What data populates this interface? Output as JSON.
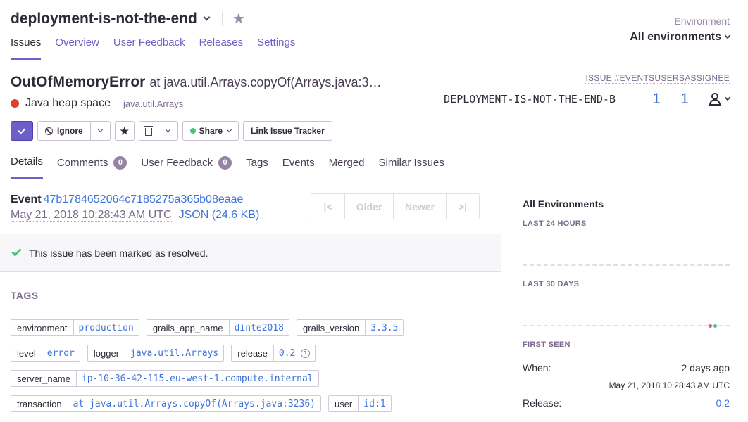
{
  "header": {
    "project_name": "deployment-is-not-the-end",
    "nav": [
      "Issues",
      "Overview",
      "User Feedback",
      "Releases",
      "Settings"
    ],
    "environment_label": "Environment",
    "environment_value": "All environments"
  },
  "issue": {
    "title": "OutOfMemoryError",
    "culprit": "at java.util.Arrays.copyOf(Arrays.java:3…",
    "message": "Java heap space",
    "location": "java.util.Arrays",
    "stats_header": "ISSUE #EVENTSUSERSASSIGNEE",
    "short_id": "DEPLOYMENT-IS-NOT-THE-END-B",
    "events": "1",
    "users": "1"
  },
  "actions": {
    "ignore": "Ignore",
    "share": "Share",
    "link_tracker": "Link Issue Tracker"
  },
  "tabs": [
    {
      "label": "Details"
    },
    {
      "label": "Comments",
      "badge": "0"
    },
    {
      "label": "User Feedback",
      "badge": "0"
    },
    {
      "label": "Tags"
    },
    {
      "label": "Events"
    },
    {
      "label": "Merged"
    },
    {
      "label": "Similar Issues"
    }
  ],
  "event": {
    "label": "Event",
    "id": "47b1784652064c7185275a365b08eaae",
    "date": "May 21, 2018 10:28:43 AM UTC",
    "json": "JSON (24.6 KB)",
    "pager": {
      "first": "|<",
      "older": "Older",
      "newer": "Newer",
      "last": ">|"
    }
  },
  "resolved_message": "This issue has been marked as resolved.",
  "tags_title": "TAGS",
  "tags": [
    {
      "key": "environment",
      "value": "production"
    },
    {
      "key": "grails_app_name",
      "value": "dinte2018"
    },
    {
      "key": "grails_version",
      "value": "3.3.5"
    },
    {
      "key": "level",
      "value": "error"
    },
    {
      "key": "logger",
      "value": "java.util.Arrays"
    },
    {
      "key": "release",
      "value": "0.2"
    },
    {
      "key": "server_name",
      "value": "ip-10-36-42-115.eu-west-1.compute.internal"
    },
    {
      "key": "transaction",
      "value": "at java.util.Arrays.copyOf(Arrays.java:3236)"
    },
    {
      "key": "user",
      "value": "id:1"
    }
  ],
  "sidebar": {
    "title": "All Environments",
    "last_24_hours": "LAST 24 HOURS",
    "last_30_days": "LAST 30 DAYS",
    "first_seen": "FIRST SEEN",
    "when_label": "When:",
    "when_value": "2 days ago",
    "when_date": "May 21, 2018 10:28:43 AM UTC",
    "release_label": "Release:",
    "release_value": "0.2"
  },
  "colors": {
    "accent": "#6c5fc7",
    "link": "#3d74db",
    "error_dot": "#e03e2f",
    "success": "#4bc57e"
  }
}
